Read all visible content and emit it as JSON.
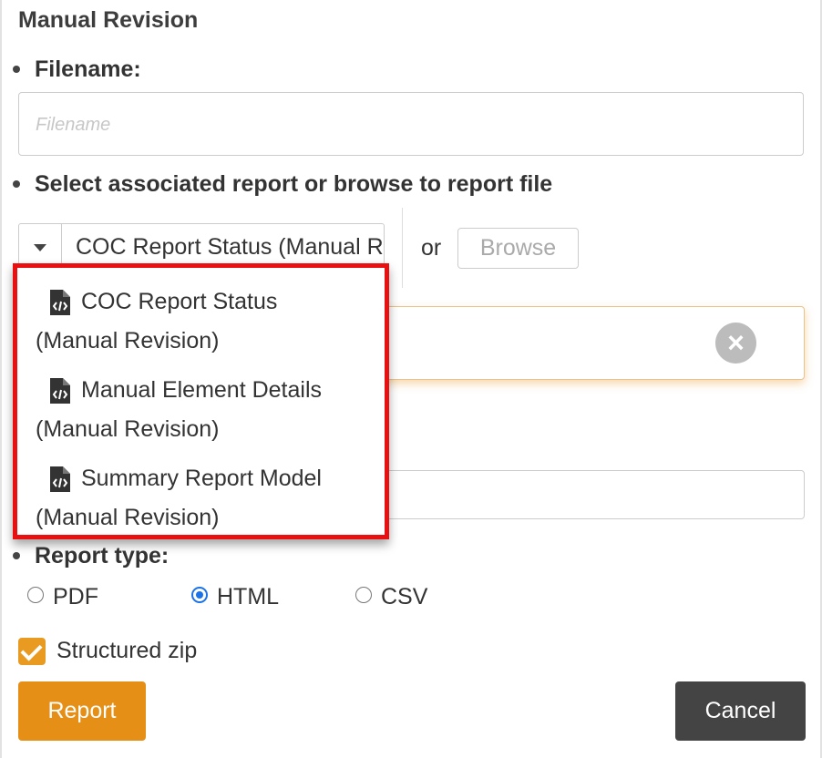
{
  "dialog": {
    "title": "Manual Revision"
  },
  "filename": {
    "label": "Filename:",
    "placeholder": "Filename",
    "value": ""
  },
  "associated_report": {
    "label": "Select associated report or browse to report file",
    "selected": "COC Report Status (Manual Revision)",
    "or_text": "or",
    "browse_label": "Browse",
    "options": [
      {
        "line1": "COC Report Status",
        "line2": "(Manual Revision)",
        "icon": "code-file-icon"
      },
      {
        "line1": "Manual Element Details",
        "line2": "(Manual Revision)",
        "icon": "code-file-icon"
      },
      {
        "line1": "Summary Report Model",
        "line2": "(Manual Revision)",
        "icon": "code-file-icon"
      }
    ]
  },
  "clear_icon": "clear-circle-icon",
  "report_type": {
    "label": "Report type:",
    "options": [
      {
        "label": "PDF",
        "checked": false
      },
      {
        "label": "HTML",
        "checked": true
      },
      {
        "label": "CSV",
        "checked": false
      }
    ]
  },
  "structured_zip": {
    "label": "Structured zip",
    "checked": true
  },
  "buttons": {
    "report": "Report",
    "cancel": "Cancel"
  },
  "colors": {
    "primary": "#e58f16",
    "cancel": "#444444",
    "highlight": "#e81010",
    "radio_selected": "#1a73e8"
  }
}
